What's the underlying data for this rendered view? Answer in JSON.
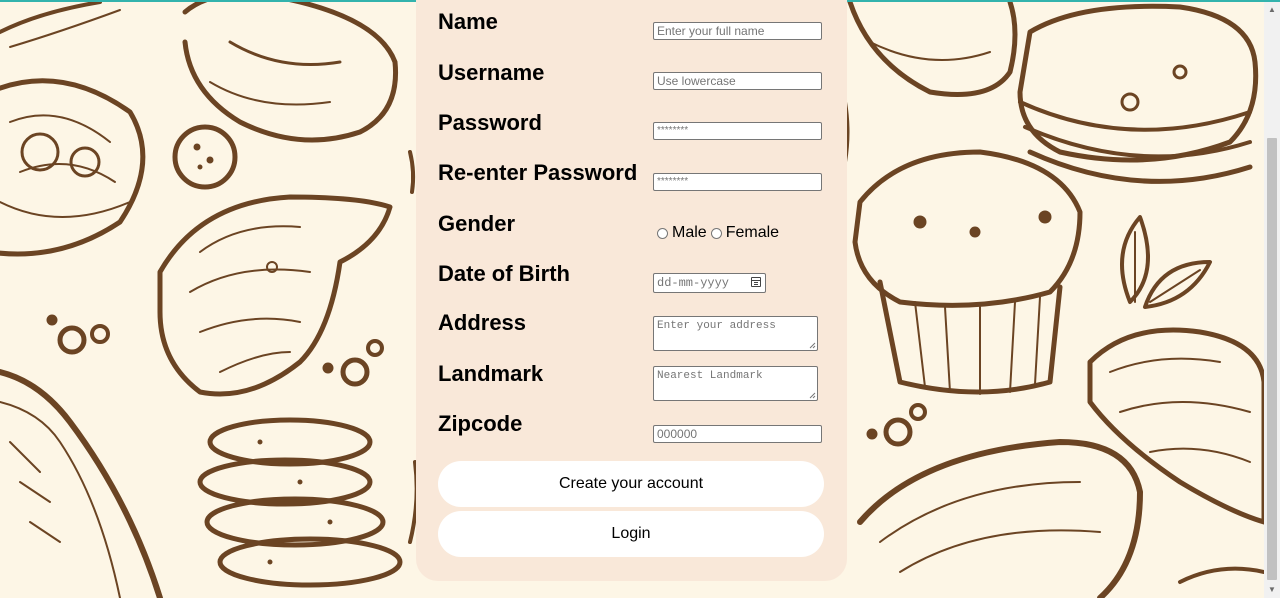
{
  "form": {
    "name_label": "Name",
    "name_placeholder": "Enter your full name",
    "username_label": "Username",
    "username_placeholder": "Use lowercase",
    "password_label": "Password",
    "password_placeholder": "********",
    "reenter_label": "Re-enter Password",
    "reenter_placeholder": "********",
    "gender_label": "Gender",
    "gender_options": [
      "Male",
      "Female"
    ],
    "dob_label": "Date of Birth",
    "dob_placeholder": "dd-mm-yyyy",
    "address_label": "Address",
    "address_placeholder": "Enter your address",
    "landmark_label": "Landmark",
    "landmark_placeholder": "Nearest Landmark",
    "zipcode_label": "Zipcode",
    "zipcode_placeholder": "000000",
    "create_button": "Create your account",
    "login_button": "Login"
  },
  "colors": {
    "card_background": "#f9e8d9",
    "page_background": "#fdf6e6",
    "illustration_brown": "#6b4423",
    "accent_top_rule": "#33b3ad"
  },
  "icons": {
    "date_picker": "calendar-icon",
    "background": "pastry-illustration-pattern"
  }
}
